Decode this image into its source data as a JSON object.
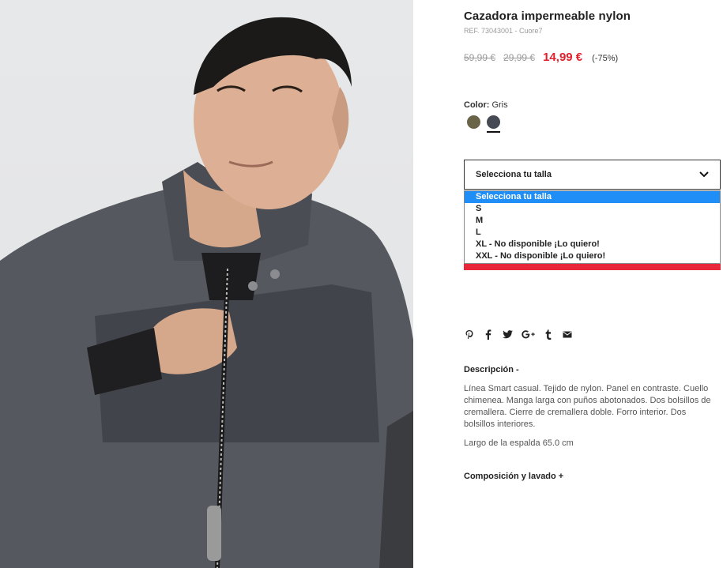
{
  "product": {
    "title": "Cazadora impermeable nylon",
    "ref": "REF. 73043001 - Cuore7",
    "old_price_1": "59,99 €",
    "old_price_2": "29,99 €",
    "price": "14,99 €",
    "discount": "(-75%)"
  },
  "color": {
    "label": "Color:",
    "value": "Gris",
    "swatches": [
      {
        "name": "olive",
        "hex": "#6a6448"
      },
      {
        "name": "gris",
        "hex": "#454a54",
        "selected": true
      }
    ]
  },
  "size_select": {
    "placeholder": "Selecciona tu talla",
    "options": [
      "Selecciona tu talla",
      "S",
      "M",
      "L",
      "XL - No disponible ¡Lo quiero!",
      "XXL - No disponible ¡Lo quiero!"
    ],
    "highlight_color": "#1f8ff7"
  },
  "share": {
    "icons": [
      "pinterest-icon",
      "facebook-icon",
      "twitter-icon",
      "google-plus-icon",
      "tumblr-icon",
      "email-icon"
    ]
  },
  "description": {
    "heading": "Descripción -",
    "text": "Línea Smart casual. Tejido de nylon. Panel en contraste. Cuello chimenea. Manga larga con puños abotonados. Dos bolsillos de cremallera. Cierre de cremallera doble. Forro interior. Dos bolsillos interiores.",
    "length": "Largo de la espalda 65.0 cm"
  },
  "composition": {
    "heading": "Composición y lavado +"
  },
  "colors": {
    "price_red": "#e2202c",
    "bar_red": "#e8283a"
  }
}
